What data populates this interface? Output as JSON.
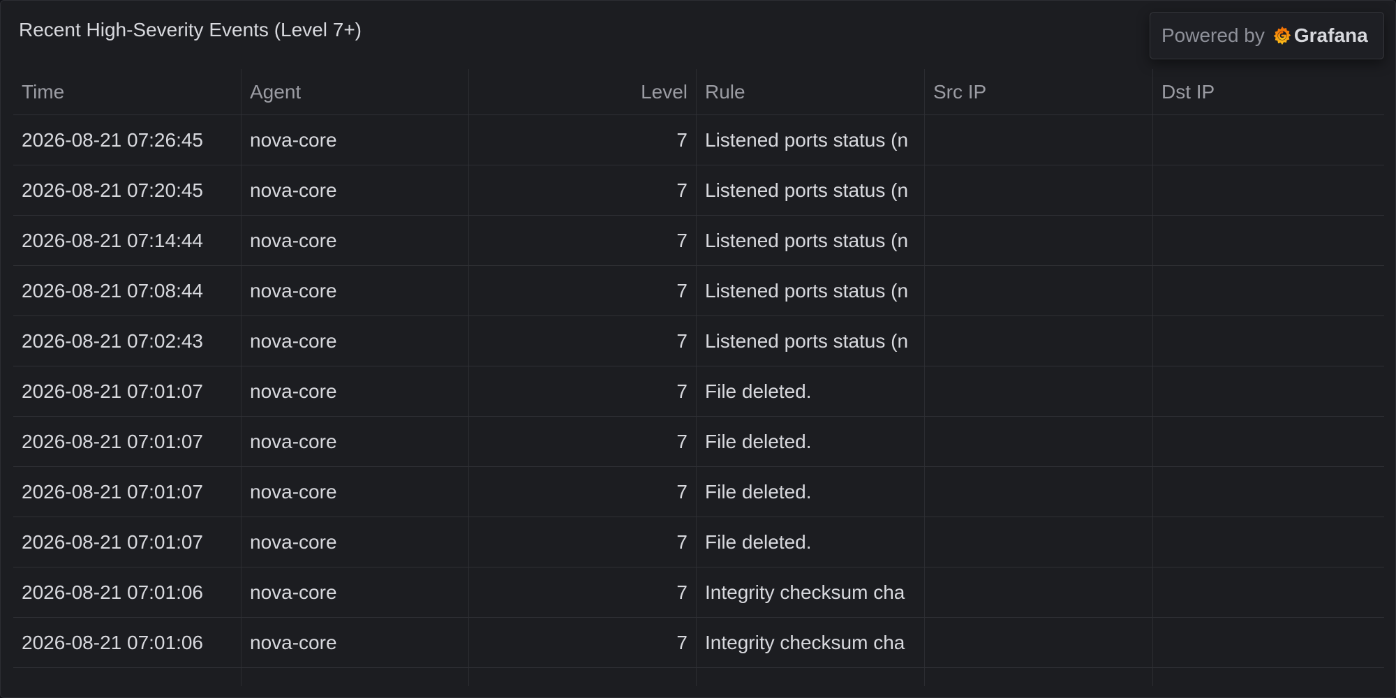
{
  "panel": {
    "title": "Recent High-Severity Events (Level 7+)"
  },
  "powered_by": {
    "text": "Powered by",
    "brand": "Grafana",
    "icon": "grafana-logo-icon"
  },
  "colors": {
    "background": "#1c1d21",
    "text": "#d8d9de",
    "header_text": "#9b9ca3",
    "brand_orange": "#f46800",
    "brand_yellow": "#fbc11a"
  },
  "table": {
    "columns": [
      "Time",
      "Agent",
      "Level",
      "Rule",
      "Src IP",
      "Dst IP"
    ],
    "rows": [
      {
        "time": "2026-08-21 07:26:45",
        "agent": "nova-core",
        "level": "7",
        "rule": "Listened ports status (n",
        "src_ip": "",
        "dst_ip": ""
      },
      {
        "time": "2026-08-21 07:20:45",
        "agent": "nova-core",
        "level": "7",
        "rule": "Listened ports status (n",
        "src_ip": "",
        "dst_ip": ""
      },
      {
        "time": "2026-08-21 07:14:44",
        "agent": "nova-core",
        "level": "7",
        "rule": "Listened ports status (n",
        "src_ip": "",
        "dst_ip": ""
      },
      {
        "time": "2026-08-21 07:08:44",
        "agent": "nova-core",
        "level": "7",
        "rule": "Listened ports status (n",
        "src_ip": "",
        "dst_ip": ""
      },
      {
        "time": "2026-08-21 07:02:43",
        "agent": "nova-core",
        "level": "7",
        "rule": "Listened ports status (n",
        "src_ip": "",
        "dst_ip": ""
      },
      {
        "time": "2026-08-21 07:01:07",
        "agent": "nova-core",
        "level": "7",
        "rule": "File deleted.",
        "src_ip": "",
        "dst_ip": ""
      },
      {
        "time": "2026-08-21 07:01:07",
        "agent": "nova-core",
        "level": "7",
        "rule": "File deleted.",
        "src_ip": "",
        "dst_ip": ""
      },
      {
        "time": "2026-08-21 07:01:07",
        "agent": "nova-core",
        "level": "7",
        "rule": "File deleted.",
        "src_ip": "",
        "dst_ip": ""
      },
      {
        "time": "2026-08-21 07:01:07",
        "agent": "nova-core",
        "level": "7",
        "rule": "File deleted.",
        "src_ip": "",
        "dst_ip": ""
      },
      {
        "time": "2026-08-21 07:01:06",
        "agent": "nova-core",
        "level": "7",
        "rule": "Integrity checksum cha",
        "src_ip": "",
        "dst_ip": ""
      },
      {
        "time": "2026-08-21 07:01:06",
        "agent": "nova-core",
        "level": "7",
        "rule": "Integrity checksum cha",
        "src_ip": "",
        "dst_ip": ""
      }
    ]
  }
}
